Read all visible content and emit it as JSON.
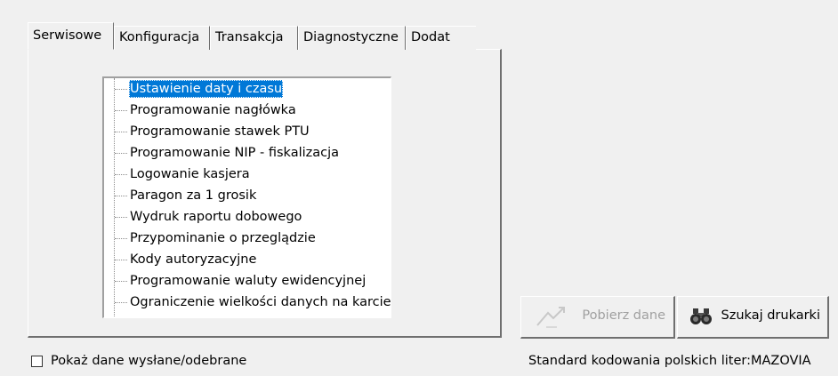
{
  "tabs": [
    {
      "label": "Serwisowe",
      "active": true
    },
    {
      "label": "Konfiguracja",
      "active": false
    },
    {
      "label": "Transakcja",
      "active": false
    },
    {
      "label": "Diagnostyczne",
      "active": false
    },
    {
      "label": "Dodat",
      "active": false
    }
  ],
  "tree": {
    "items": [
      {
        "label": "Ustawienie daty i czasu",
        "selected": true
      },
      {
        "label": "Programowanie nagłówka",
        "selected": false
      },
      {
        "label": "Programowanie stawek PTU",
        "selected": false
      },
      {
        "label": "Programowanie NIP - fiskalizacja",
        "selected": false
      },
      {
        "label": "Logowanie kasjera",
        "selected": false
      },
      {
        "label": "Paragon za 1 grosik",
        "selected": false
      },
      {
        "label": "Wydruk raportu dobowego",
        "selected": false
      },
      {
        "label": "Przypominanie o przeglądzie",
        "selected": false
      },
      {
        "label": "Kody autoryzacyjne",
        "selected": false
      },
      {
        "label": "Programowanie waluty ewidencyjnej",
        "selected": false
      },
      {
        "label": "Ograniczenie wielkości danych na karcie",
        "selected": false
      }
    ]
  },
  "buttons": {
    "fetch": {
      "label": "Pobierz dane",
      "enabled": false,
      "icon": "download-arrow-icon"
    },
    "find_printer": {
      "label": "Szukaj drukarki",
      "enabled": true,
      "icon": "binoculars-icon"
    }
  },
  "checkbox": {
    "label": "Pokaż dane wysłane/odebrane",
    "checked": false
  },
  "status": {
    "encoding_text": "Standard kodowania polskich liter:MAZOVIA"
  },
  "colors": {
    "selection": "#0078d7",
    "background": "#f0f0f0",
    "disabled_text": "#a0a0a0"
  }
}
